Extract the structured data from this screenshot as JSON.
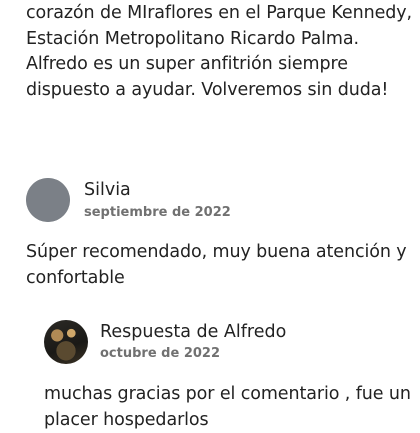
{
  "top_review": {
    "text": "corazón de MIraflores en el Parque Kennedy, Estación Metropolitano Ricardo Palma. Alfredo es un super anfitrión siempre dispuesto a ayudar. Volveremos sin duda!"
  },
  "review": {
    "author": "Silvia",
    "date": "septiembre de 2022",
    "text": "Súper recomendado, muy buena atención y confortable"
  },
  "reply": {
    "title": "Respuesta de Alfredo",
    "date": "octubre de 2022",
    "text": "muchas gracias por el comentario , fue un placer hospedarlos"
  }
}
